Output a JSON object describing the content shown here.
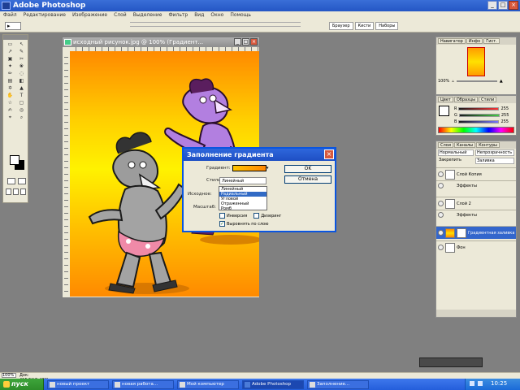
{
  "app": {
    "title": "Adobe Photoshop",
    "menu": [
      "Файл",
      "Редактирование",
      "Изображение",
      "Слой",
      "Выделение",
      "Фильтр",
      "Вид",
      "Окно",
      "Помощь"
    ]
  },
  "options_bar": {
    "tool_preset": "▸",
    "palette_tabs": [
      "Браузер",
      "Кисти",
      "Наборы"
    ]
  },
  "toolbox": {
    "tools": [
      "▭",
      "↖",
      "↗",
      "✎",
      "▣",
      "✂",
      "✦",
      "❀",
      "✏",
      "◌",
      "▤",
      "◧",
      "✡",
      "▲",
      "✋",
      "T",
      "☆",
      "▢",
      "✍",
      "◎",
      "⌖",
      "⌕"
    ]
  },
  "document": {
    "title": "исходный рисунок.jpg @ 100% (Градиент...",
    "btn_min": "_",
    "btn_max": "□",
    "btn_close": "×"
  },
  "navigator": {
    "tabs": [
      "Навигатор",
      "Инфо",
      "Гист."
    ],
    "zoom_value": "100%"
  },
  "color_palette": {
    "tabs": [
      "Цвет",
      "Образцы",
      "Стили"
    ],
    "channels": [
      {
        "label": "R",
        "value": "255"
      },
      {
        "label": "G",
        "value": "255"
      },
      {
        "label": "B",
        "value": "255"
      }
    ]
  },
  "layers": {
    "tabs": [
      "Слои",
      "Каналы",
      "Контуры"
    ],
    "blend_mode": "Нормальный",
    "opacity_label": "Непрозрачность",
    "lock_label": "Закрепить",
    "fill_label": "Заливка",
    "items": [
      {
        "name": "Слой Копия"
      },
      {
        "name": "Эффекты"
      },
      {
        "name": "Слой 2"
      },
      {
        "name": "Эффекты"
      },
      {
        "name": "Градиентная заливка"
      },
      {
        "name": "Фон"
      }
    ]
  },
  "status": {
    "zoom": "100%",
    "doc_info": "Док: 415,5К/1,46М"
  },
  "dialog": {
    "title": "Заполнение градиента",
    "gradient_label": "Градиент:",
    "style_label": "Стиль:",
    "style_value": "Линейный",
    "angle_label": "Исходное:",
    "scale_label": "Масштаб:",
    "options": [
      "Линейный",
      "Радиальный",
      "Угловой",
      "Отраженный",
      "Ромб"
    ],
    "selected_option": 1,
    "reverse_label": "Инверсия",
    "dither_label": "Дизеринг",
    "align_label": "Выровнять по слою",
    "ok": "OK",
    "cancel": "Отмена",
    "close": "×"
  },
  "taskbar": {
    "start": "пуск",
    "items": [
      {
        "label": "новый проект"
      },
      {
        "label": "новая работа..."
      },
      {
        "label": "Мой компьютер"
      },
      {
        "label": "Adobe Photoshop"
      },
      {
        "label": "Заполнение..."
      }
    ],
    "clock": "10:25"
  },
  "colors": {
    "titlebar_blue": "#2456c4",
    "taskbar_blue": "#245edb",
    "gradient_orange": "#ff8a00",
    "gradient_yellow": "#fff200"
  }
}
